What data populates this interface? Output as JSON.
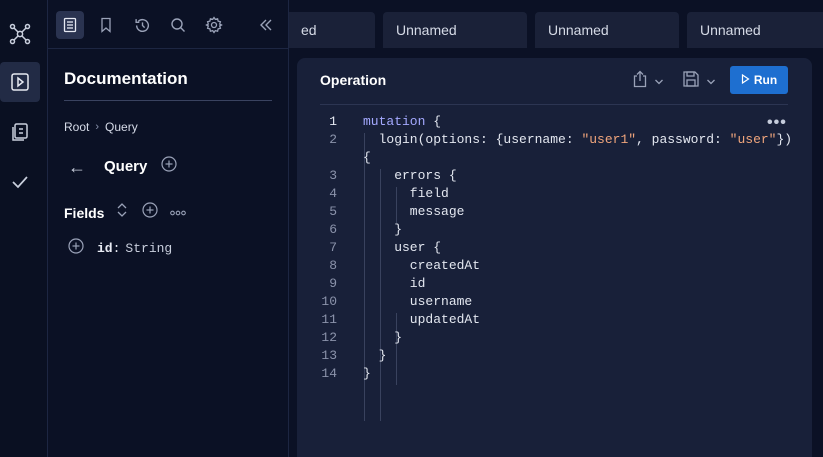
{
  "rail": {
    "items": [
      {
        "name": "graph-icon",
        "active": false
      },
      {
        "name": "play-icon",
        "active": true
      },
      {
        "name": "collection-icon",
        "active": false
      },
      {
        "name": "check-icon",
        "active": false
      }
    ]
  },
  "sidebar": {
    "toolbar": [
      "docs-icon",
      "bookmark-icon",
      "history-icon",
      "search-icon",
      "settings-icon",
      "collapse-icon"
    ],
    "title": "Documentation",
    "breadcrumb": {
      "root": "Root",
      "sep": "›",
      "current": "Query"
    },
    "back_label": "←",
    "section_title": "Query",
    "fields_label": "Fields",
    "fields": [
      {
        "name": "id",
        "colon": ":",
        "type": "String"
      }
    ]
  },
  "tabs": [
    {
      "label": "ed"
    },
    {
      "label": "Unnamed"
    },
    {
      "label": "Unnamed"
    },
    {
      "label": "Unnamed"
    }
  ],
  "editor": {
    "title": "Operation",
    "run_label": "Run",
    "more_label": "•••",
    "lines": [
      "1",
      "2",
      "",
      "3",
      "4",
      "5",
      "6",
      "7",
      "8",
      "9",
      "10",
      "11",
      "12",
      "13",
      "14"
    ]
  },
  "colors": {
    "background": "#0b1125",
    "panel": "#182039",
    "accent": "#1e6fd0",
    "keyword": "#a4a9ff",
    "string": "#f0a57c"
  }
}
